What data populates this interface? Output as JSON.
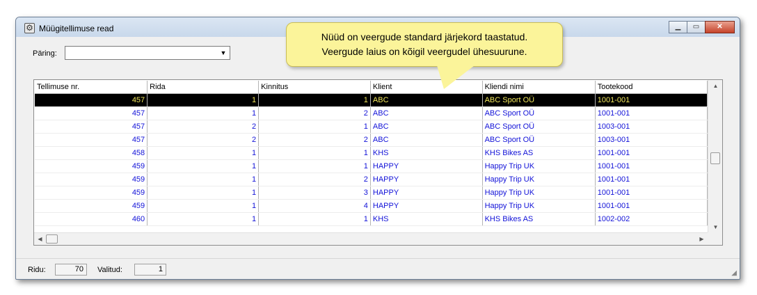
{
  "window": {
    "title": "Müügitellimuse read",
    "icon": "app-gear-icon"
  },
  "query": {
    "label": "Päring:",
    "value": ""
  },
  "grid": {
    "columns": [
      "Tellimuse nr.",
      "Rida",
      "Kinnitus",
      "Klient",
      "Kliendi nimi",
      "Tootekood"
    ],
    "rows": [
      [
        "457",
        "1",
        "1",
        "ABC",
        "ABC Sport OÜ",
        "1001-001"
      ],
      [
        "457",
        "1",
        "2",
        "ABC",
        "ABC Sport OÜ",
        "1001-001"
      ],
      [
        "457",
        "2",
        "1",
        "ABC",
        "ABC Sport OÜ",
        "1003-001"
      ],
      [
        "457",
        "2",
        "2",
        "ABC",
        "ABC Sport OÜ",
        "1003-001"
      ],
      [
        "458",
        "1",
        "1",
        "KHS",
        "KHS Bikes AS",
        "1001-001"
      ],
      [
        "459",
        "1",
        "1",
        "HAPPY",
        "Happy Trip UK",
        "1001-001"
      ],
      [
        "459",
        "1",
        "2",
        "HAPPY",
        "Happy Trip UK",
        "1001-001"
      ],
      [
        "459",
        "1",
        "3",
        "HAPPY",
        "Happy Trip UK",
        "1001-001"
      ],
      [
        "459",
        "1",
        "4",
        "HAPPY",
        "Happy Trip UK",
        "1001-001"
      ],
      [
        "460",
        "1",
        "1",
        "KHS",
        "KHS Bikes AS",
        "1002-002"
      ]
    ],
    "selected_row": 0
  },
  "status": {
    "rows_label": "Ridu:",
    "rows_value": "70",
    "selected_label": "Valitud:",
    "selected_value": "1"
  },
  "callout": {
    "line1": "Nüüd on veergude standard järjekord taastatud.",
    "line2": "Veergude laius on kõigil veergudel ühesuurune."
  },
  "colors": {
    "cell_text": "#1212d8",
    "selected_bg": "#000000",
    "selected_text": "#f2e75c",
    "callout_bg": "#fbf49a"
  }
}
